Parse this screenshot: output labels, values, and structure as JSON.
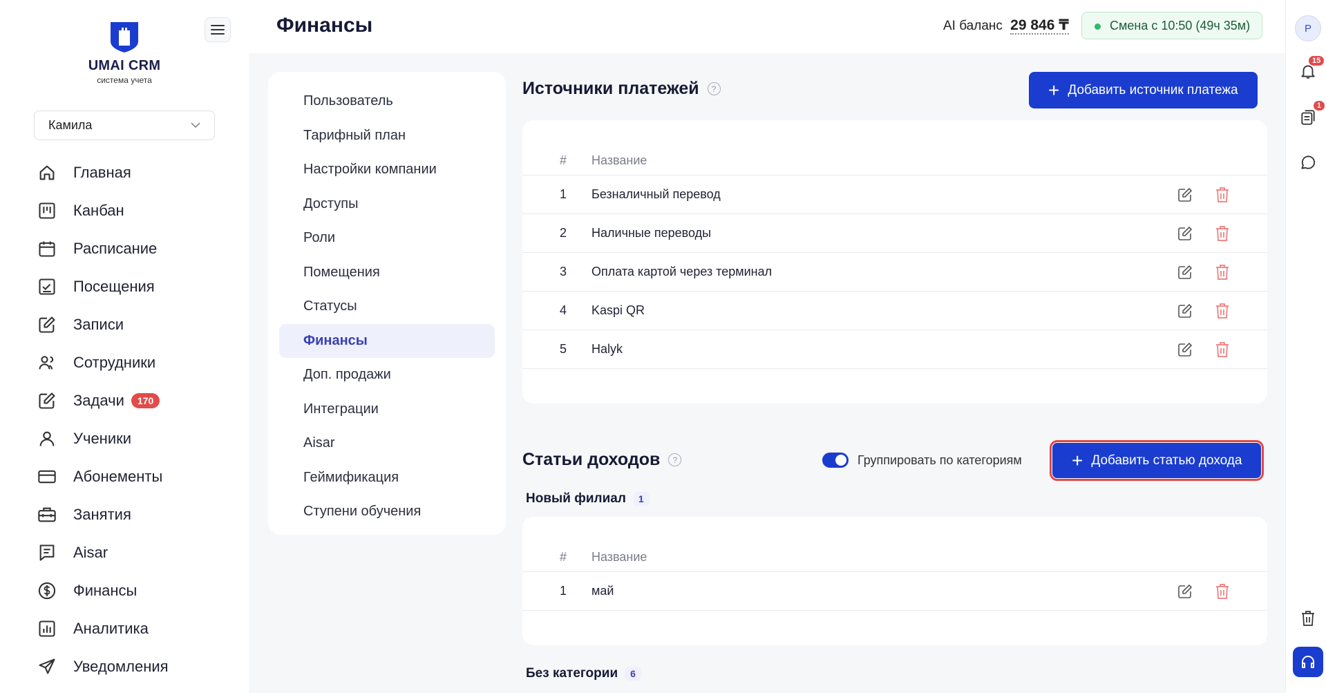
{
  "app": {
    "brand": "UMAI CRM",
    "brand_sub": "система учета"
  },
  "branch_select": {
    "value": "Камила"
  },
  "nav": [
    {
      "label": "Главная",
      "icon": "home-icon"
    },
    {
      "label": "Канбан",
      "icon": "kanban-icon"
    },
    {
      "label": "Расписание",
      "icon": "calendar-icon"
    },
    {
      "label": "Посещения",
      "icon": "attendance-icon"
    },
    {
      "label": "Записи",
      "icon": "edit-icon"
    },
    {
      "label": "Сотрудники",
      "icon": "users-icon"
    },
    {
      "label": "Задачи",
      "icon": "tasks-icon",
      "badge": "170"
    },
    {
      "label": "Ученики",
      "icon": "user-icon"
    },
    {
      "label": "Абонементы",
      "icon": "card-icon"
    },
    {
      "label": "Занятия",
      "icon": "briefcase-icon"
    },
    {
      "label": "Aisar",
      "icon": "chat-doc-icon"
    },
    {
      "label": "Финансы",
      "icon": "dollar-icon"
    },
    {
      "label": "Аналитика",
      "icon": "chart-icon"
    },
    {
      "label": "Уведомления",
      "icon": "send-icon"
    }
  ],
  "header": {
    "title": "Финансы",
    "ai_balance_label": "AI баланс",
    "ai_balance_value": "29 846 ₸",
    "shift": "Смена с 10:50 (49ч 35м)"
  },
  "rail": {
    "avatar": "P",
    "notifications_badge": "15",
    "docs_badge": "1"
  },
  "settings_menu": [
    "Пользователь",
    "Тарифный план",
    "Настройки компании",
    "Доступы",
    "Роли",
    "Помещения",
    "Статусы",
    "Финансы",
    "Доп. продажи",
    "Интеграции",
    "Aisar",
    "Геймификация",
    "Ступени обучения"
  ],
  "payment_sources": {
    "title": "Источники платежей",
    "add_button": "Добавить источник платежа",
    "col_num": "#",
    "col_name": "Название",
    "rows": [
      {
        "n": "1",
        "name": "Безналичный перевод"
      },
      {
        "n": "2",
        "name": "Наличные переводы"
      },
      {
        "n": "3",
        "name": "Оплата картой через терминал"
      },
      {
        "n": "4",
        "name": "Kaspi QR"
      },
      {
        "n": "5",
        "name": "Halyk"
      }
    ]
  },
  "income_items": {
    "title": "Статьи доходов",
    "group_toggle_label": "Группировать по категориям",
    "add_button": "Добавить статью дохода",
    "groups": [
      {
        "name": "Новый филиал",
        "count": "1",
        "col_num": "#",
        "col_name": "Название",
        "rows": [
          {
            "n": "1",
            "name": "май"
          }
        ]
      },
      {
        "name": "Без категории",
        "count": "6"
      }
    ]
  },
  "colors": {
    "accent": "#1a3ccf",
    "danger": "#e14b4b",
    "success": "#2ebb66"
  }
}
